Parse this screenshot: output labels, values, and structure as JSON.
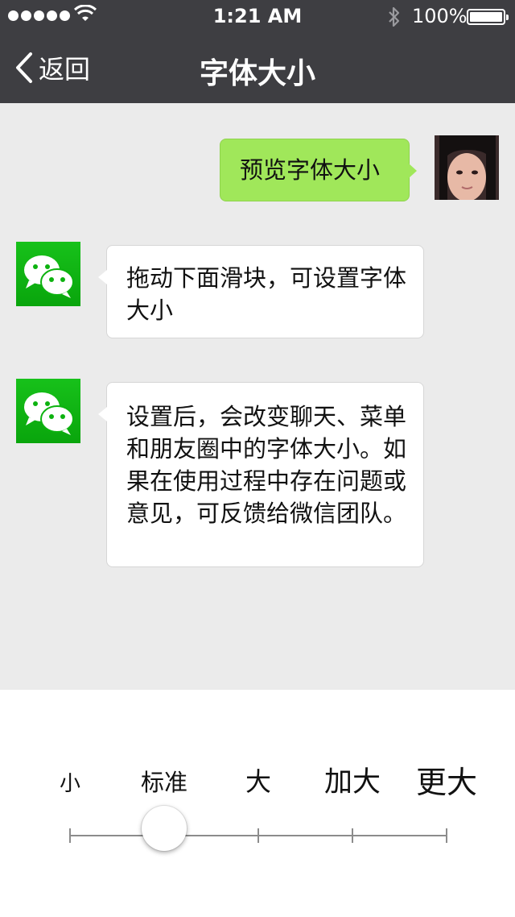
{
  "status_bar": {
    "time": "1:21 AM",
    "battery": "100%"
  },
  "nav": {
    "back_label": "返回",
    "title": "字体大小"
  },
  "messages": [
    {
      "side": "right",
      "avatar": "user-avatar",
      "text": "预览字体大小"
    },
    {
      "side": "left",
      "avatar": "wechat-logo-icon",
      "text": "拖动下面滑块，可设置字体大小"
    },
    {
      "side": "left",
      "avatar": "wechat-logo-icon",
      "text": "设置后，会改变聊天、菜单和朋友圈中的字体大小。如果在使用过程中存在问题或意见，可反馈给微信团队。"
    }
  ],
  "font_size_slider": {
    "options": [
      "小",
      "标准",
      "大",
      "加大",
      "更大"
    ],
    "selected_index": 1,
    "selected_label": "标准"
  },
  "colors": {
    "nav_bg": "#3e3e42",
    "chat_bg": "#ebebeb",
    "sent_bubble": "#a0e75a",
    "received_bubble": "#ffffff",
    "wechat_green": "#09b80e"
  }
}
